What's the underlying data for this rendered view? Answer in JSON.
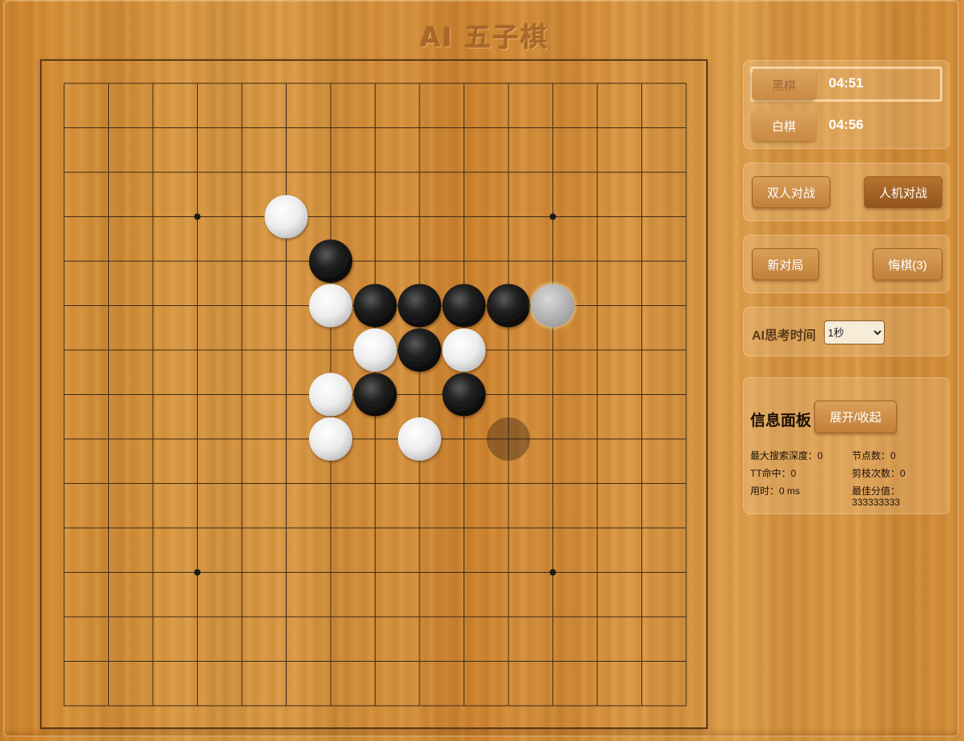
{
  "title": "AI 五子棋",
  "board": {
    "size": 15,
    "star_points": [
      [
        3,
        3
      ],
      [
        3,
        11
      ],
      [
        11,
        3
      ],
      [
        11,
        11
      ]
    ],
    "stones": [
      {
        "row": 3,
        "col": 5,
        "color": "white"
      },
      {
        "row": 4,
        "col": 6,
        "color": "black"
      },
      {
        "row": 5,
        "col": 6,
        "color": "white"
      },
      {
        "row": 5,
        "col": 7,
        "color": "black"
      },
      {
        "row": 5,
        "col": 8,
        "color": "black"
      },
      {
        "row": 5,
        "col": 9,
        "color": "black"
      },
      {
        "row": 5,
        "col": 10,
        "color": "black"
      },
      {
        "row": 5,
        "col": 11,
        "color": "white-last"
      },
      {
        "row": 6,
        "col": 7,
        "color": "white"
      },
      {
        "row": 6,
        "col": 8,
        "color": "black"
      },
      {
        "row": 6,
        "col": 9,
        "color": "white"
      },
      {
        "row": 7,
        "col": 6,
        "color": "white"
      },
      {
        "row": 7,
        "col": 7,
        "color": "black"
      },
      {
        "row": 7,
        "col": 9,
        "color": "black"
      },
      {
        "row": 8,
        "col": 6,
        "color": "white"
      },
      {
        "row": 8,
        "col": 8,
        "color": "white"
      },
      {
        "row": 8,
        "col": 10,
        "color": "hover"
      }
    ]
  },
  "players": {
    "black": {
      "label": "黑棋",
      "time": "04:51",
      "active": true
    },
    "white": {
      "label": "白棋",
      "time": "04:56",
      "active": false
    }
  },
  "mode": {
    "pvp_label": "双人对战",
    "pve_label": "人机对战",
    "active": "pve"
  },
  "controls": {
    "new_game_label": "新对局",
    "undo_label": "悔棋(3)"
  },
  "ai_time": {
    "label": "AI思考时间",
    "selected": "1秒",
    "options": [
      "1秒"
    ]
  },
  "info": {
    "title": "信息面板",
    "toggle_label": "展开/收起",
    "max_depth": "最大搜索深度：0",
    "nodes": "节点数：0",
    "tt_hits": "TT命中：0",
    "prunes": "剪枝次数：0",
    "time_used": "用时：0 ms",
    "best_score_label": "最佳分值：",
    "best_score_value": "333333333"
  },
  "colors": {
    "accent": "#c2803a",
    "line": "#3c2a18",
    "black_stone": "#1a1a1a",
    "white_stone": "#eeeeee"
  }
}
